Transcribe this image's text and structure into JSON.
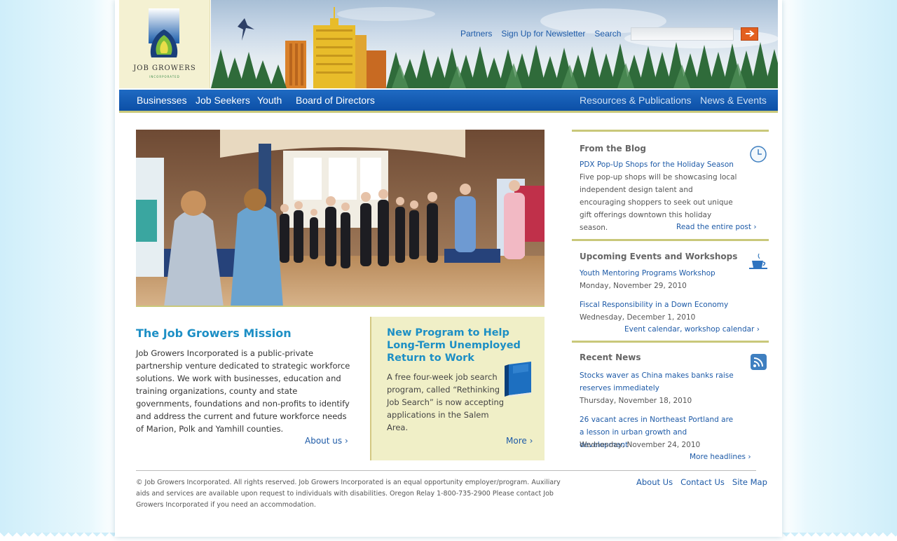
{
  "brand": {
    "name": "JOB GROWERS",
    "sub": "INCORPORATED",
    "colors": {
      "nav_blue": "#0c4fa6",
      "accent_blue": "#1d8fc5",
      "link_blue": "#1d5aa7",
      "olive_rule": "#c9c87a",
      "promo_bg": "#f0efc7",
      "search_orange": "#e3601f"
    }
  },
  "utility": {
    "links": [
      "Partners",
      "Sign Up for Newsletter",
      "Search"
    ],
    "search_placeholder": "",
    "search_button_icon": "arrow-right-icon"
  },
  "nav": {
    "left": [
      "Businesses",
      "Job Seekers",
      "Youth",
      "Board of Directors"
    ],
    "right": [
      "Resources & Publications",
      "News & Events"
    ]
  },
  "mission": {
    "title": "The Job Growers Mission",
    "text": "Job Growers Incorporated is a public-private partnership venture dedicated to strategic workforce solutions. We work with businesses, education and training organizations, county and state governments, foundations and non-profits to identify and address the current and future workforce needs of Marion, Polk and Yamhill counties.",
    "link": "About us ›"
  },
  "promo": {
    "title": "New Program to Help Long-Term Unemployed Return to Work",
    "text": "A free four-week job search program, called “Rethinking Job Search” is now accepting applications in the Salem Area.",
    "link": "More ›",
    "icon": "book-icon"
  },
  "blog": {
    "title": "From the Blog",
    "icon": "clock-icon",
    "post_title": "PDX Pop-Up Shops for the Holiday Season",
    "excerpt": "Five pop-up shops will be showcasing local independent design talent and encouraging shoppers to seek out unique gift offerings downtown this holiday season.",
    "more": "Read the entire post ›"
  },
  "events": {
    "title": "Upcoming Events and Workshops",
    "icon": "coffee-cup-icon",
    "items": [
      {
        "title": "Youth Mentoring Programs Workshop",
        "date": "Monday, November 29, 2010"
      },
      {
        "title": "Fiscal Responsibility in a Down Economy",
        "date": "Wednesday, December 1, 2010"
      }
    ],
    "more": "Event calendar, workshop calendar ›"
  },
  "news": {
    "title": "Recent News",
    "icon": "rss-icon",
    "items": [
      {
        "title": "Stocks waver as China makes banks raise reserves immediately",
        "date": "Thursday, November 18, 2010"
      },
      {
        "title": "26 vacant acres in Northeast Portland are a lesson in urban growth and development",
        "date": "Wednesday, November 24, 2010"
      }
    ],
    "more": "More headlines ›"
  },
  "footer": {
    "copyright": "© Job Growers Incorporated. All rights reserved. Job Growers Incorporated is an equal opportunity employer/program.  Auxiliary aids and services are available upon request to individuals with disabilities. Oregon Relay 1-800-735-2900 Please contact Job Growers Incorporated if you need an accommodation.",
    "links": [
      "About Us",
      "Contact Us",
      "Site Map"
    ]
  }
}
